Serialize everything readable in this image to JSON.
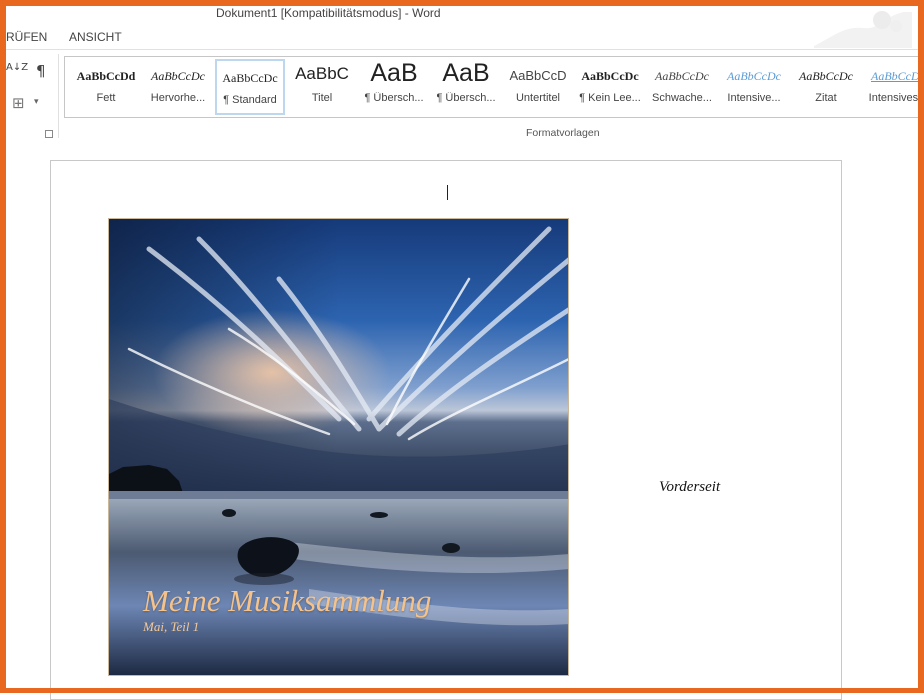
{
  "window": {
    "title": "Dokument1 [Kompatibilitätsmodus] - Word"
  },
  "tabs": [
    "RÜFEN",
    "ANSICHT"
  ],
  "paragraph_tools": {
    "sort_glyph": "A↓Z",
    "pilcrow_glyph": "¶",
    "borders_glyph": "⊞",
    "dropdown_glyph": "▾"
  },
  "styles": {
    "group_label": "Formatvorlagen",
    "items": [
      {
        "sample": "AaBbCcDd",
        "label": "Fett"
      },
      {
        "sample": "AaBbCcDc",
        "label": "Hervorhe..."
      },
      {
        "sample": "AaBbCcDc",
        "label": "¶ Standard"
      },
      {
        "sample": "AaBbC",
        "label": "Titel"
      },
      {
        "sample": "AaB",
        "label": "¶ Übersch..."
      },
      {
        "sample": "AaB",
        "label": "¶ Übersch..."
      },
      {
        "sample": "AaBbCcD",
        "label": "Untertitel"
      },
      {
        "sample": "AaBbCcDc",
        "label": "¶ Kein Lee..."
      },
      {
        "sample": "AaBbCcDc",
        "label": "Schwache..."
      },
      {
        "sample": "AaBbCcDc",
        "label": "Intensive..."
      },
      {
        "sample": "AaBbCcDc",
        "label": "Zitat"
      },
      {
        "sample": "AaBbCcDc",
        "label": "Intensives..."
      }
    ],
    "selected": "¶ Standard"
  },
  "document": {
    "cover_title": "Meine Musiksammlung",
    "cover_subtitle": "Mai, Teil 1",
    "side_text": "Vorderseit"
  },
  "colors": {
    "frame": "#e8681f",
    "selection_border": "#bcd7ee",
    "accent_blue": "#5b9bd5",
    "cover_text": "#f5c28a"
  }
}
